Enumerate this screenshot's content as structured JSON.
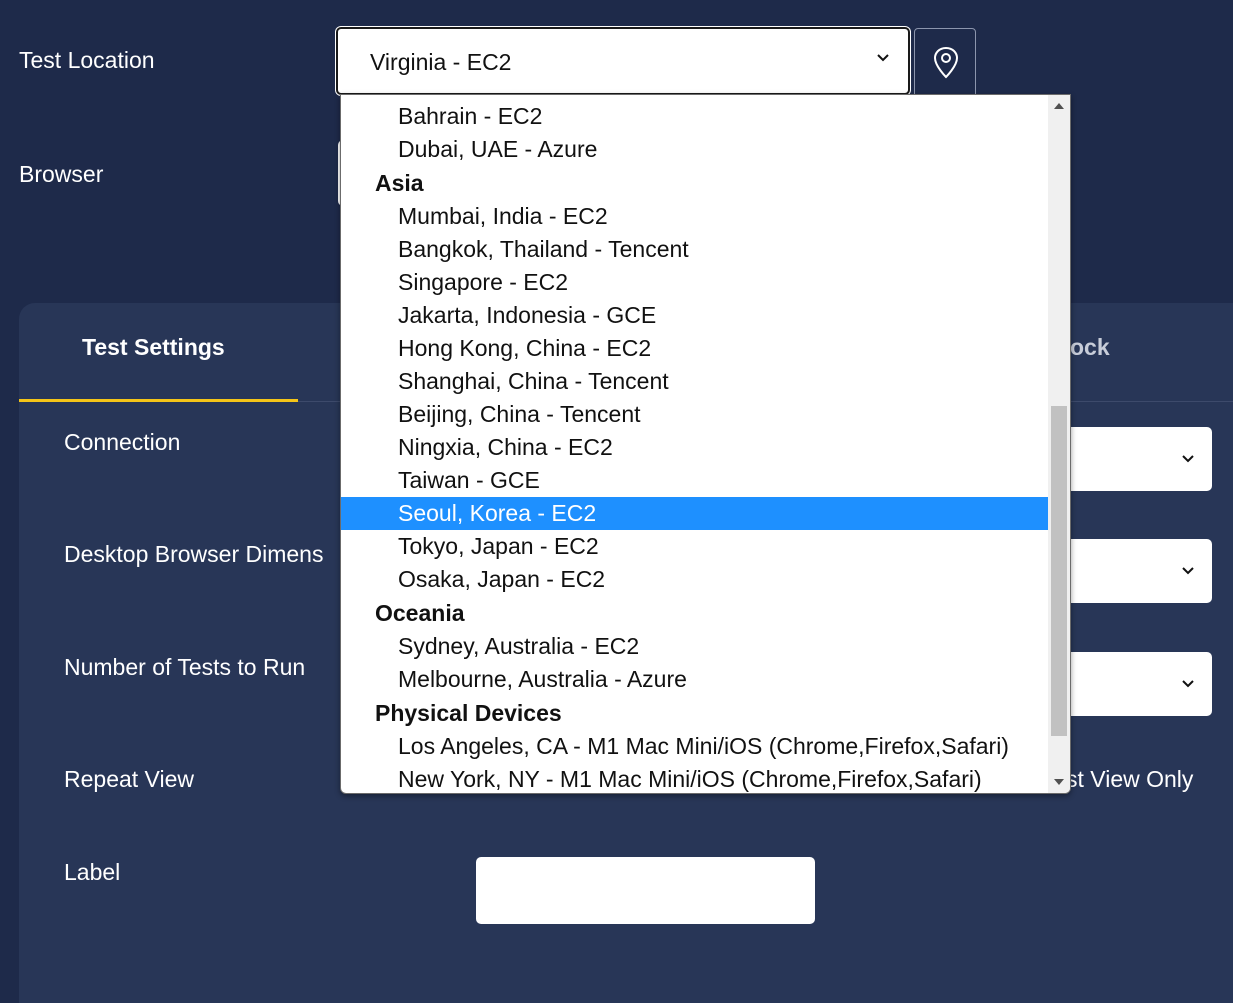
{
  "form": {
    "test_location_label": "Test Location",
    "test_location_value": "Virginia - EC2",
    "browser_label": "Browser"
  },
  "tabs": {
    "active": "Test Settings",
    "partial": "ock"
  },
  "settings": {
    "connection": "Connection",
    "desktop_browser_dimensions": "Desktop Browser Dimens",
    "number_of_tests": "Number of Tests to Run",
    "repeat_view": "Repeat View",
    "repeat_view_option_partial": "st View Only",
    "label": "Label"
  },
  "dropdown": {
    "items": [
      {
        "text": "Bahrain - EC2",
        "kind": "option"
      },
      {
        "text": "Dubai, UAE - Azure",
        "kind": "option"
      },
      {
        "text": "Asia",
        "kind": "group"
      },
      {
        "text": "Mumbai, India - EC2",
        "kind": "option"
      },
      {
        "text": "Bangkok, Thailand - Tencent",
        "kind": "option"
      },
      {
        "text": "Singapore - EC2",
        "kind": "option"
      },
      {
        "text": "Jakarta, Indonesia - GCE",
        "kind": "option"
      },
      {
        "text": "Hong Kong, China - EC2",
        "kind": "option"
      },
      {
        "text": "Shanghai, China - Tencent",
        "kind": "option"
      },
      {
        "text": "Beijing, China - Tencent",
        "kind": "option"
      },
      {
        "text": "Ningxia, China - EC2",
        "kind": "option"
      },
      {
        "text": "Taiwan - GCE",
        "kind": "option"
      },
      {
        "text": "Seoul, Korea - EC2",
        "kind": "option",
        "highlighted": true
      },
      {
        "text": "Tokyo, Japan - EC2",
        "kind": "option"
      },
      {
        "text": "Osaka, Japan - EC2",
        "kind": "option"
      },
      {
        "text": "Oceania",
        "kind": "group"
      },
      {
        "text": "Sydney, Australia - EC2",
        "kind": "option"
      },
      {
        "text": "Melbourne, Australia - Azure",
        "kind": "option"
      },
      {
        "text": "Physical Devices",
        "kind": "group"
      },
      {
        "text": "Los Angeles, CA - M1 Mac Mini/iOS (Chrome,Firefox,Safari)",
        "kind": "option"
      },
      {
        "text": "New York, NY - M1 Mac Mini/iOS (Chrome,Firefox,Safari)",
        "kind": "option"
      }
    ]
  },
  "colors": {
    "background": "#1e2a4a",
    "panel": "#283657",
    "tab_underline": "#f5c518",
    "highlight": "#1e90ff"
  },
  "icons": [
    "chevron-down-icon",
    "map-pin-icon",
    "scroll-up-arrow-icon",
    "scroll-down-arrow-icon"
  ]
}
